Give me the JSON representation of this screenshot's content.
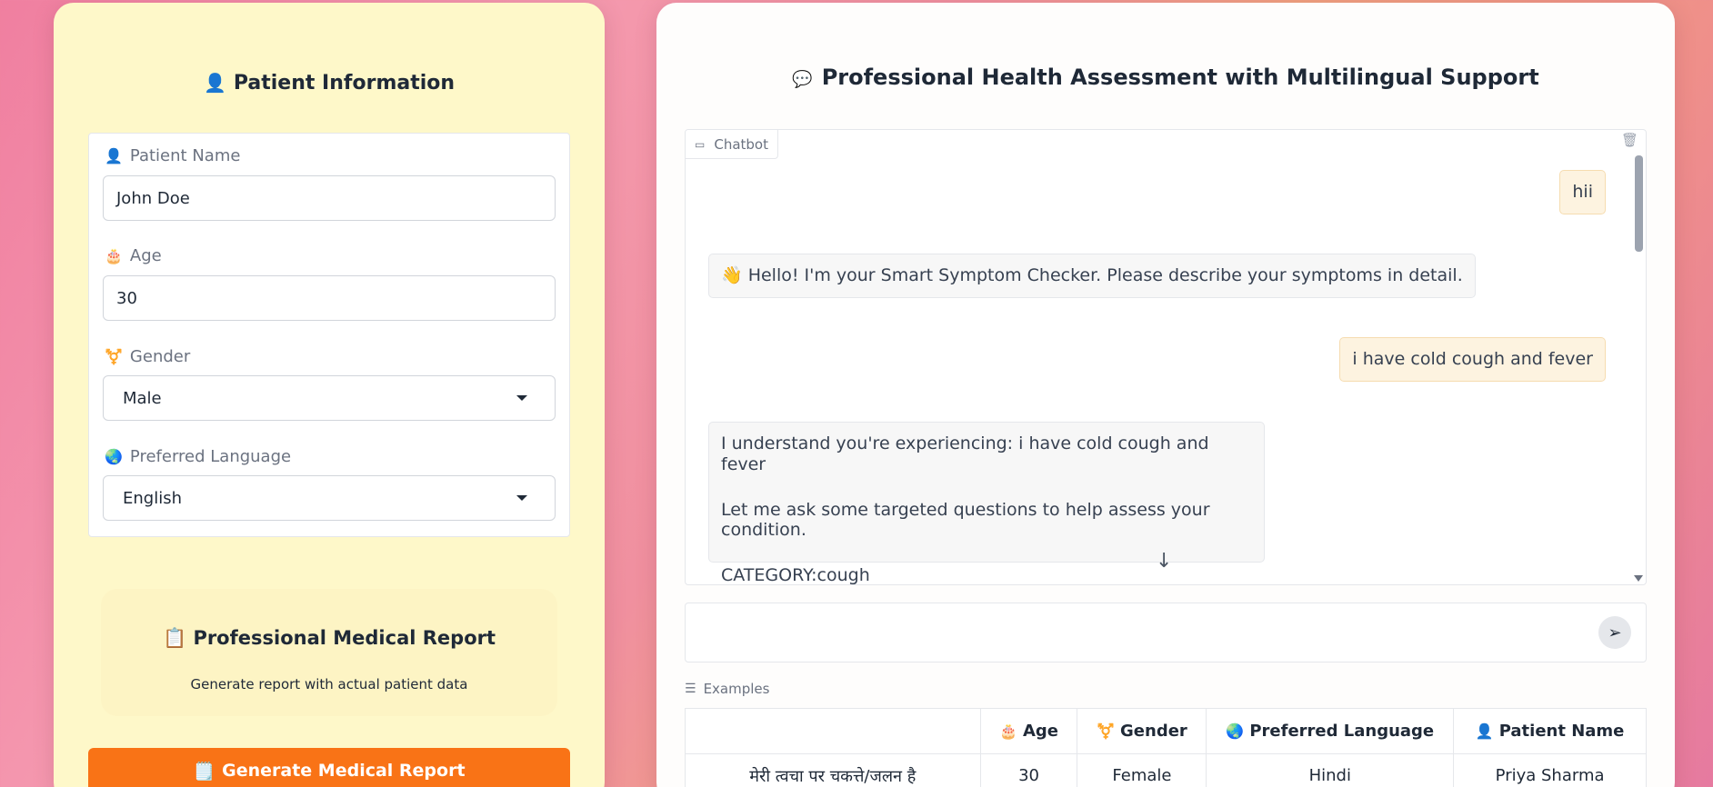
{
  "patient_panel": {
    "title": "Patient Information",
    "title_icon": "👤",
    "fields": {
      "name": {
        "label": "Patient Name",
        "icon": "👤",
        "value": "John Doe"
      },
      "age": {
        "label": "Age",
        "icon": "🎂",
        "value": "30"
      },
      "gender": {
        "label": "Gender",
        "icon": "⚧️",
        "value": "Male"
      },
      "language": {
        "label": "Preferred Language",
        "icon": "🌏",
        "value": "English"
      }
    },
    "report": {
      "title": "Professional Medical Report",
      "icon": "📋",
      "subtitle": "Generate report with actual patient data"
    },
    "generate_button": {
      "label": "Generate Medical Report",
      "icon": "🗒️"
    }
  },
  "assessment": {
    "title": "Professional Health Assessment with Multilingual Support",
    "title_icon": "💬",
    "chatbot": {
      "label": "Chatbot",
      "label_icon": "💬",
      "messages": [
        {
          "role": "user",
          "text": "hii"
        },
        {
          "role": "bot",
          "text": "👋 Hello! I'm your Smart Symptom Checker. Please describe your symptoms in detail."
        },
        {
          "role": "user",
          "text": "i have cold cough and fever"
        },
        {
          "role": "bot",
          "lines": [
            "I understand you're experiencing: i have cold cough and fever",
            "Let me ask some targeted questions to help assess your condition.",
            "CATEGORY:cough"
          ]
        }
      ]
    },
    "input": {
      "value": "",
      "placeholder": ""
    },
    "examples": {
      "label": "Examples",
      "headers": [
        {
          "label": "",
          "icon": ""
        },
        {
          "label": "Age",
          "icon": "🎂"
        },
        {
          "label": "Gender",
          "icon": "⚧️"
        },
        {
          "label": "Preferred Language",
          "icon": "🌏"
        },
        {
          "label": "Patient Name",
          "icon": "👤"
        }
      ],
      "rows": [
        [
          "मेरी त्वचा पर चकत्ते/जलन है",
          "30",
          "Female",
          "Hindi",
          "Priya Sharma"
        ]
      ]
    }
  },
  "colors": {
    "left_panel_bg": "#fef8c9",
    "accent_orange": "#f97316",
    "user_bubble": "#fdf3e0",
    "bot_bubble": "#f7f7f7"
  }
}
